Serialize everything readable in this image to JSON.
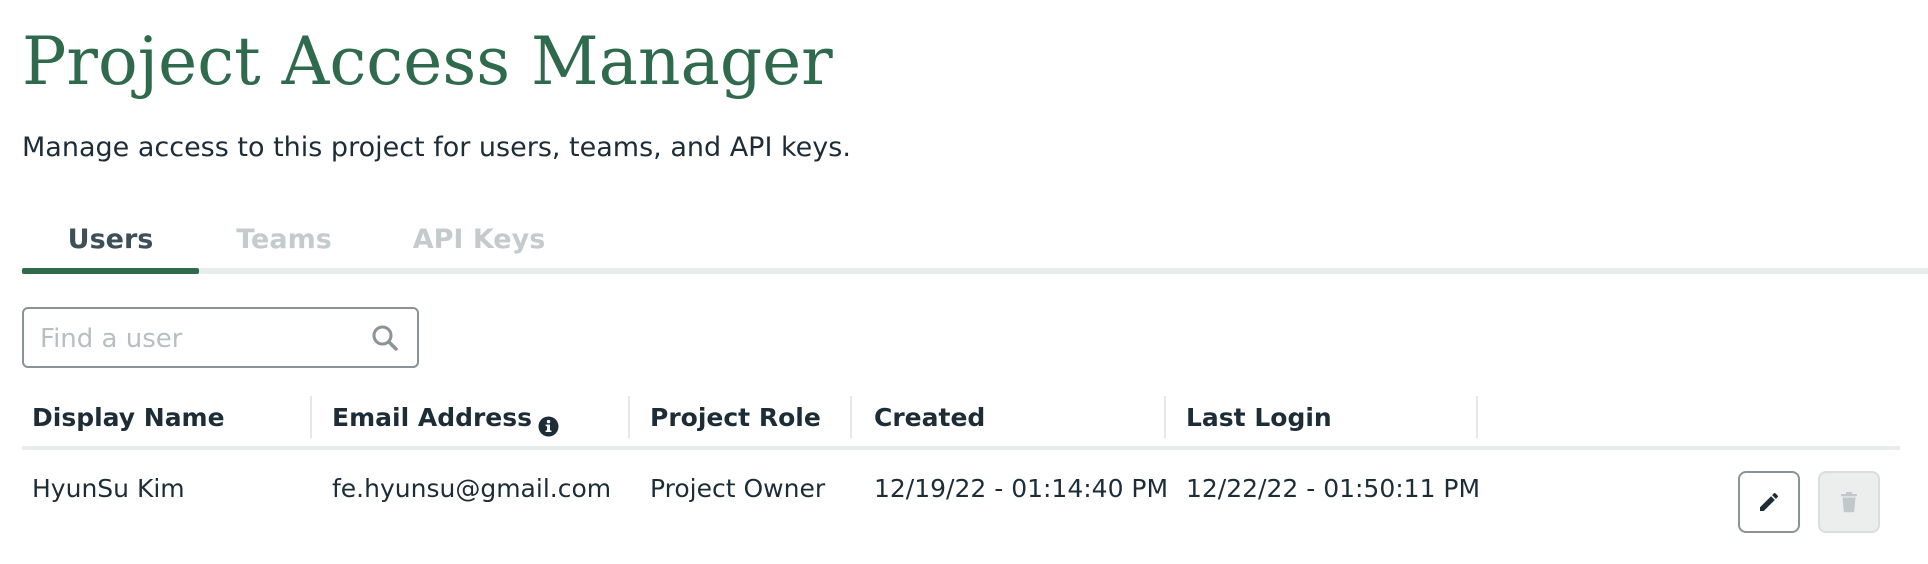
{
  "header": {
    "title": "Project Access Manager",
    "subtitle": "Manage access to this project for users, teams, and API keys."
  },
  "tabs": [
    {
      "label": "Users",
      "active": true
    },
    {
      "label": "Teams",
      "active": false
    },
    {
      "label": "API Keys",
      "active": false
    }
  ],
  "search": {
    "placeholder": "Find a user",
    "value": "",
    "icon": "search-icon"
  },
  "table": {
    "columns": [
      "Display Name",
      "Email Address",
      "Project Role",
      "Created",
      "Last Login"
    ],
    "email_info_icon": "info-icon",
    "rows": [
      {
        "display_name": "HyunSu Kim",
        "email": "fe.hyunsu@gmail.com",
        "role": "Project Owner",
        "created": "12/19/22 - 01:14:40 PM",
        "last_login": "12/22/22 - 01:50:11 PM",
        "actions": {
          "edit_icon": "pencil-icon",
          "delete_icon": "trash-icon",
          "delete_disabled": true
        }
      }
    ]
  },
  "colors": {
    "accent": "#2f6a4c",
    "text": "#1c2d38",
    "tab_inactive": "#c5cbcd",
    "border": "#8a9396"
  }
}
